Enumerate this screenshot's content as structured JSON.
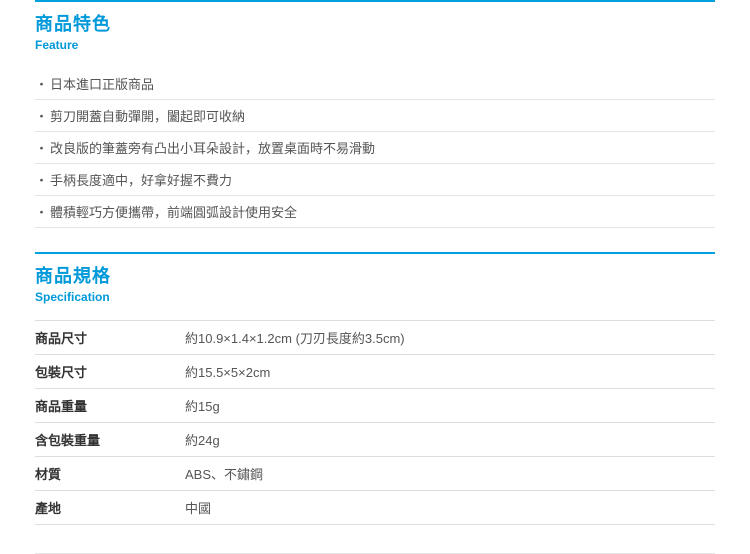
{
  "feature": {
    "title": "商品特色",
    "subtitle": "Feature",
    "items": [
      "日本進口正版商品",
      "剪刀開蓋自動彈開，闔起即可收納",
      "改良版的筆蓋旁有凸出小耳朵設計，放置桌面時不易滑動",
      "手柄長度適中，好拿好握不費力",
      "體積輕巧方便攜帶，前端圓弧設計使用安全"
    ]
  },
  "spec": {
    "title": "商品規格",
    "subtitle": "Specification",
    "rows": [
      {
        "label": "商品尺寸",
        "value": "約10.9×1.4×1.2cm (刀刃長度約3.5cm)"
      },
      {
        "label": "包裝尺寸",
        "value": "約15.5×5×2cm"
      },
      {
        "label": "商品重量",
        "value": "約15g"
      },
      {
        "label": "含包裝重量",
        "value": "約24g"
      },
      {
        "label": "材質",
        "value": "ABS、不鏽鋼"
      },
      {
        "label": "產地",
        "value": "中國"
      }
    ]
  }
}
